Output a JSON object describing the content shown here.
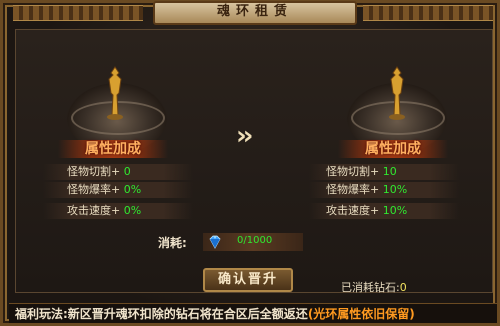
{
  "window": {
    "title": "魂环租赁"
  },
  "left_panel": {
    "title": "属性加成",
    "stats": [
      {
        "label": "怪物切割+",
        "value": "0"
      },
      {
        "label": "怪物爆率+",
        "value": "0%"
      },
      {
        "label": "攻击速度+",
        "value": "0%"
      }
    ]
  },
  "right_panel": {
    "title": "属性加成",
    "stats": [
      {
        "label": "怪物切割+",
        "value": "10"
      },
      {
        "label": "怪物爆率+",
        "value": "10%"
      },
      {
        "label": "攻击速度+",
        "value": "10%"
      }
    ]
  },
  "arrows": "››",
  "cost": {
    "label": "消耗:",
    "value": "0/1000",
    "icon": "diamond-icon"
  },
  "confirm_button": "确认晋升",
  "consumed": {
    "label": "已消耗钻石:",
    "value": "0"
  },
  "footer": {
    "text": "福利玩法:新区晋升魂环扣除的钻石将在合区后全额返还",
    "highlight": "(光环属性依旧保留)"
  },
  "colors": {
    "stat_value": "#30e830",
    "highlight": "#ff9a20",
    "title_accent": "#ffb060"
  }
}
